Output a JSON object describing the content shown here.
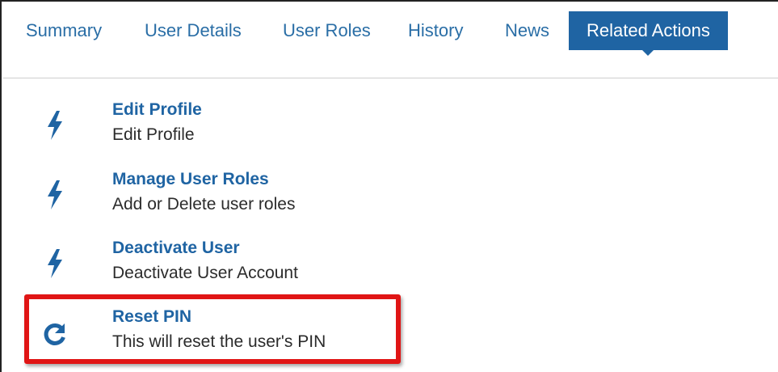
{
  "tabs": [
    {
      "label": "Summary",
      "active": false
    },
    {
      "label": "User Details",
      "active": false
    },
    {
      "label": "User Roles",
      "active": false
    },
    {
      "label": "History",
      "active": false
    },
    {
      "label": "News",
      "active": false
    },
    {
      "label": "Related Actions",
      "active": true
    }
  ],
  "related_actions": [
    {
      "title": "Edit Profile",
      "description": "Edit Profile",
      "icon": "lightning-bolt-icon"
    },
    {
      "title": "Manage User Roles",
      "description": "Add or Delete user roles",
      "icon": "lightning-bolt-icon"
    },
    {
      "title": "Deactivate User",
      "description": "Deactivate User Account",
      "icon": "lightning-bolt-icon"
    },
    {
      "title": "Reset PIN",
      "description": "This will reset the user's PIN",
      "icon": "refresh-icon"
    }
  ],
  "colors": {
    "link": "#1f64a3",
    "active_tab_bg": "#1f64a3",
    "highlight_border": "#e01515",
    "text": "#2b2b2b"
  }
}
